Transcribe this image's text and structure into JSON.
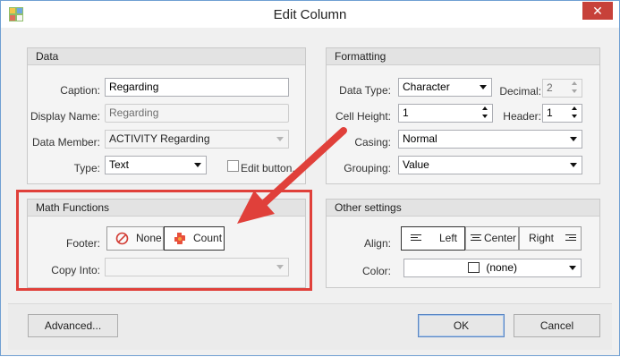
{
  "window": {
    "title": "Edit Column",
    "close_glyph": "✕"
  },
  "data_group": {
    "header": "Data",
    "caption_label": "Caption:",
    "caption_value": "Regarding",
    "display_name_label": "Display Name:",
    "display_name_value": "Regarding",
    "data_member_label": "Data Member:",
    "data_member_value": "ACTIVITY Regarding",
    "type_label": "Type:",
    "type_value": "Text",
    "edit_button_label": "Edit button."
  },
  "formatting_group": {
    "header": "Formatting",
    "data_type_label": "Data Type:",
    "data_type_value": "Character",
    "decimal_label": "Decimal:",
    "decimal_value": "2",
    "cell_height_label": "Cell Height:",
    "cell_height_value": "1",
    "header_label": "Header:",
    "header_value": "1",
    "casing_label": "Casing:",
    "casing_value": "Normal",
    "grouping_label": "Grouping:",
    "grouping_value": "Value"
  },
  "math_group": {
    "header": "Math Functions",
    "footer_label": "Footer:",
    "footer_options": [
      {
        "label": "None",
        "icon": "none-circle-slash-icon"
      },
      {
        "label": "Count",
        "icon": "count-puzzle-icon",
        "selected": true
      }
    ],
    "copy_into_label": "Copy Into:",
    "copy_into_value": ""
  },
  "other_group": {
    "header": "Other settings",
    "align_label": "Align:",
    "align_options": [
      "Left",
      "Center",
      "Right"
    ],
    "align_selected": "Left",
    "color_label": "Color:",
    "color_value": "(none)"
  },
  "buttons": {
    "advanced": "Advanced...",
    "ok": "OK",
    "cancel": "Cancel"
  },
  "colors": {
    "highlight": "#e0403a",
    "close_button": "#c7413a"
  }
}
